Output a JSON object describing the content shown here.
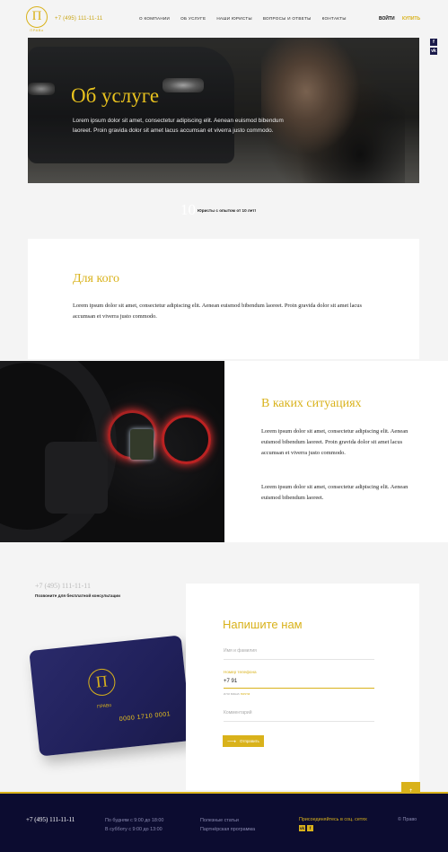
{
  "header": {
    "logo_letter": "П",
    "logo_caption": "ПРАВо",
    "phone": "+7 (495) 111-11-11",
    "nav": [
      "О компании",
      "Об услуге",
      "Наши юристы",
      "Вопросы и ответы",
      "Контакты"
    ],
    "login": "ВОЙТИ",
    "buy": "КУПИТЬ"
  },
  "side_social": [
    "f",
    "vk"
  ],
  "hero": {
    "title": "Об услуге",
    "text": "Lorem ipsum dolor sit amet, consectetur adipiscing elit. Aenean euismod bibendum laoreet. Proin gravida dolor sit amet lacus accumsan et viverra justo commodo."
  },
  "stat": {
    "number": "10",
    "text": "Юристы с опытом от 10 лет!"
  },
  "for_whom": {
    "title": "Для кого",
    "text": "Lorem ipsum dolor sit amet, consectetur adipiscing elit. Aenean euismod bibendum laoreet. Proin gravida dolor sit amet lacus accumsan et viverra justo commodo."
  },
  "situations": {
    "title": "В каких ситуациях",
    "p1": "Lorem ipsum dolor sit amet, consectetur adipiscing elit. Aenean euismod bibendum laoreet. Proin gravida dolor sit amet lacus accumsan et viverra justo commodo.",
    "p2": "Lorem ipsum dolor sit amet, consectetur adipiscing elit. Aenean euismod bibendum laoreet."
  },
  "contact": {
    "phone": "+7 (495) 111-11-11",
    "call_text": "Позвоните для бесплатной консультации"
  },
  "card": {
    "letter": "П",
    "brand": "ПРАВо",
    "number": "0000 1710 0001"
  },
  "form": {
    "title": "Напишите нам",
    "name_placeholder": "Имя и фамилия",
    "phone_label": "Номер телефона",
    "phone_value": "+7 91",
    "phone_hint_prefix": "или ваша",
    "phone_hint_link": "почта",
    "comment_placeholder": "Комментарий",
    "send_label": "Отправить"
  },
  "footer": {
    "phone": "+7 (495) 111-11-11",
    "hours1": "По будням с 9:00 до 18:00",
    "hours2": "В субботу с 9:00 до 13:00",
    "link1": "Полезные статьи",
    "link2": "Партнёрская программа",
    "social_label": "Присоединяйтесь в соц. сетях",
    "social_icons": [
      "vk",
      "f"
    ],
    "copyright": "© Право"
  },
  "colors": {
    "accent": "#d9b21b",
    "footer_bg": "#0c0c30",
    "card_bg": "#20205a"
  }
}
